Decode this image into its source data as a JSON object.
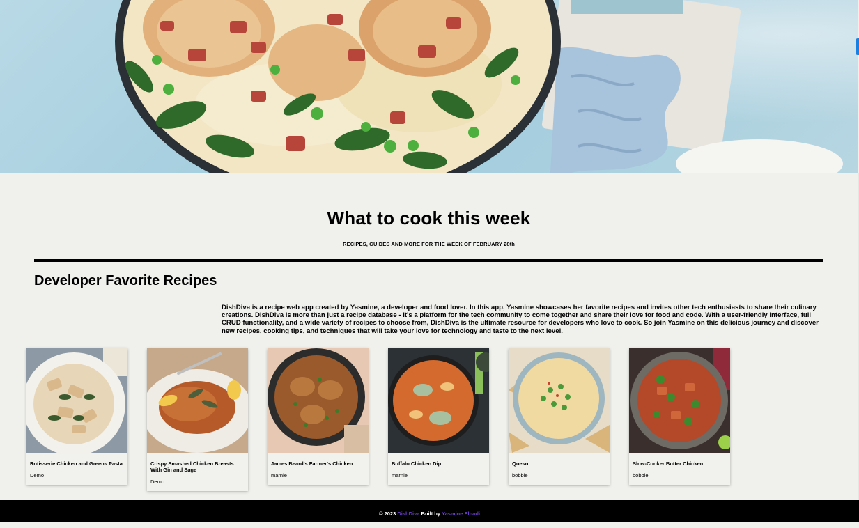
{
  "hero": {
    "image": "creamy chicken with bacon, peas and spinach in a skillet"
  },
  "headline": {
    "title": "What to cook this week",
    "subtitle": "RECIPES, GUIDES AND MORE FOR THE WEEK OF FEBRUARY 28th"
  },
  "favorites": {
    "title": "Developer Favorite Recipes",
    "about": "DishDiva is a recipe web app created by Yasmine, a developer and food lover. In this app, Yasmine showcases her favorite recipes and invites other tech enthusiasts to share their culinary creations. DishDiva is more than just a recipe database - it's a platform for the tech community to come together and share their love for food and code. With a user-friendly interface, full CRUD functionality, and a wide variety of recipes to choose from, DishDiva is the ultimate resource for developers who love to cook. So join Yasmine on this delicious journey and discover new recipes, cooking tips, and techniques that will take your love for technology and taste to the next level."
  },
  "recipes": [
    {
      "name": "Rotisserie Chicken and Greens Pasta",
      "author": "Demo"
    },
    {
      "name": "Crispy Smashed Chicken Breasts With Gin and Sage",
      "author": "Demo"
    },
    {
      "name": "James Beard's Farmer's Chicken",
      "author": "marnie"
    },
    {
      "name": "Buffalo Chicken Dip",
      "author": "marnie"
    },
    {
      "name": "Queso",
      "author": "bobbie"
    },
    {
      "name": "Slow-Cooker Butter Chicken",
      "author": "bobbie"
    }
  ],
  "footer": {
    "copyright": "© 2023",
    "brand": "DishDiva",
    "built_by": "Built by",
    "author": "Yasmine Elnadi"
  },
  "colors": {
    "background": "#f0f0ec",
    "accent_link": "#6b3ec9",
    "footer_bg": "#000000"
  }
}
